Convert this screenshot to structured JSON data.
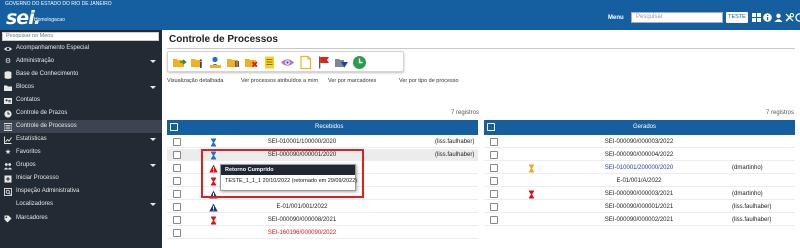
{
  "gov_bar": {
    "text": "GOVERNO DO ESTADO DO RIO DE JANEIRO"
  },
  "header": {
    "logo": "sei.",
    "environment": "Homologacao",
    "menu_label": "Menu",
    "search_placeholder": "Pesquisar",
    "unit": "TESTE",
    "icons": [
      "grid-icon",
      "info-icon",
      "user-icon",
      "tools-icon",
      "logout-icon"
    ]
  },
  "sidebar": {
    "search_placeholder": "Pesquisar no Menu",
    "items": [
      {
        "label": "Acompanhamento Especial",
        "icon": "eye-icon"
      },
      {
        "label": "Administração",
        "icon": "gear-icon",
        "expandable": true
      },
      {
        "label": "Base de Conhecimento",
        "icon": "database-icon"
      },
      {
        "label": "Blocos",
        "icon": "folder-icon",
        "expandable": true
      },
      {
        "label": "Contatos",
        "icon": "contacts-icon"
      },
      {
        "label": "Controle de Prazos",
        "icon": "clock-icon"
      },
      {
        "label": "Controle de Processos",
        "icon": "list-icon",
        "active": true
      },
      {
        "label": "Estatísticas",
        "icon": "chart-icon",
        "expandable": true
      },
      {
        "label": "Favoritos",
        "icon": "star-icon"
      },
      {
        "label": "Grupos",
        "icon": "group-icon",
        "expandable": true
      },
      {
        "label": "Iniciar Processo",
        "icon": "new-process-icon"
      },
      {
        "label": "Inspeção Administrativa",
        "icon": "inspection-icon"
      },
      {
        "label": "Localizadores",
        "icon": "",
        "expandable": true
      },
      {
        "label": "Marcadores",
        "icon": "tag-icon"
      }
    ]
  },
  "main": {
    "title": "Controle de Processos",
    "toolbar_icons": [
      "send-process-icon",
      "update-progress-icon",
      "assign-process-icon",
      "sobrestar-icon",
      "finish-process-icon",
      "include-block-icon",
      "acompanhamento-icon",
      "annotation-icon",
      "marker-icon",
      "deadline-icon",
      "blocks-icon"
    ],
    "view_links": [
      "Visualização detalhada",
      "Ver processos atribuídos a mim",
      "Ver por marcadores",
      "Ver por tipo de processo"
    ],
    "colors": {
      "header": "#155fa0",
      "red": "#e02020",
      "link_blue": "#1e3fae"
    }
  },
  "recebidos": {
    "count": "7 registros",
    "header": "Recebidos",
    "rows": [
      {
        "process": "SEI-010001/100000/2020",
        "user": "(liss.faulhaber)",
        "icon": "hourglass-blue-icon"
      },
      {
        "process": "SEI-000090/000001/2020",
        "user": "(liss.faulhaber)",
        "icon": "hourglass-blue-icon"
      },
      {
        "process": "",
        "user": "",
        "icon": "warning-red-icon"
      },
      {
        "process": "",
        "user": "",
        "icon": "hourglass-red-icon"
      },
      {
        "process": "",
        "user": "",
        "icon": "warning-blue-icon"
      },
      {
        "process": "E-01/001/001/2022",
        "user": "",
        "icon": "warning-blue-icon"
      },
      {
        "process": "SEI-000090/000008/2021",
        "user": "",
        "icon": "hourglass-red-icon"
      },
      {
        "process": "SEI-160196/000090/2022",
        "user": "",
        "icon": ""
      }
    ]
  },
  "gerados": {
    "count": "7 registros",
    "header": "Gerados",
    "rows": [
      {
        "process": "SEI-000090/000003/2022",
        "user": "",
        "icon": ""
      },
      {
        "process": "SEI-000090/000004/2022",
        "user": "",
        "icon": ""
      },
      {
        "process": "SEI-010001/200000/2020",
        "user": "(dmartinho)",
        "icon": "hourglass-orange-icon"
      },
      {
        "process": "E-01/001/A/2022",
        "user": "",
        "icon": ""
      },
      {
        "process": "SEI-000090/000003/2021",
        "user": "(dmartinho)",
        "icon": "hourglass-red-icon"
      },
      {
        "process": "SEI-000090/000001/2021",
        "user": "(liss.faulhaber)",
        "icon": ""
      },
      {
        "process": "SEI-000090/000002/2021",
        "user": "(liss.faulhaber)",
        "icon": ""
      }
    ]
  },
  "tooltip": {
    "title": "Retorno Cumprido",
    "body": "TESTE_1_1_1 20/10/2022 (retornado em 29/09/2022)"
  }
}
